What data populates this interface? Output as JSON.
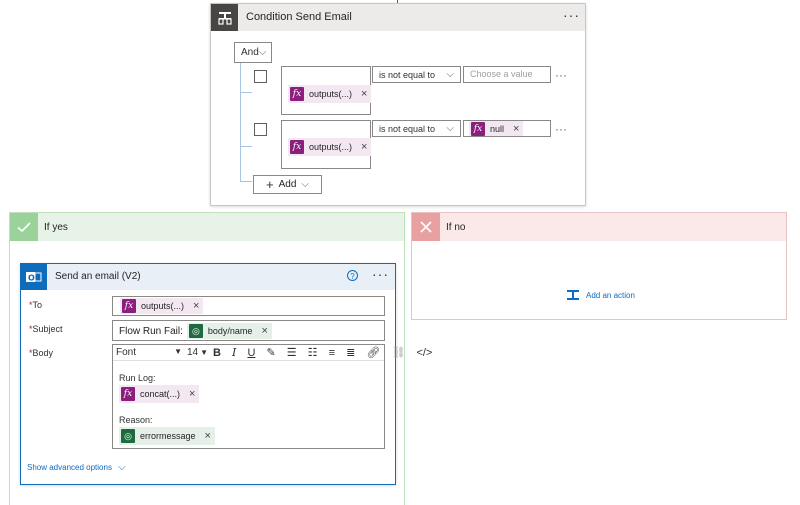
{
  "condition": {
    "title": "Condition Send Email",
    "menu": "···",
    "group_label": "And",
    "rows": [
      {
        "left_token": "outputs(...)",
        "operator": "is not equal to",
        "right_placeholder": "Choose a value",
        "right_token": ""
      },
      {
        "left_token": "outputs(...)",
        "operator": "is not equal to",
        "right_placeholder": "",
        "right_token": "null"
      }
    ],
    "row_menu": "···",
    "add_label": "Add"
  },
  "if_yes": {
    "title": "If yes"
  },
  "if_no": {
    "title": "If no",
    "add_action": "Add an action"
  },
  "email": {
    "title": "Send an email (V2)",
    "help": "?",
    "menu": "···",
    "to_label": "To",
    "to_token": "outputs(...)",
    "subject_label": "Subject",
    "subject_text": "Flow Run Fail:",
    "subject_token": "body/name",
    "body_label": "Body",
    "font": "Font",
    "font_size": "14",
    "run_log_label": "Run Log:",
    "run_log_token": "concat(...)",
    "reason_label": "Reason:",
    "reason_token": "errormessage",
    "advanced": "Show advanced options"
  },
  "colors": {
    "yes": "#e6f3e6",
    "yes_border": "#bfe0bf",
    "no": "#fbe9e9",
    "no_border": "#e8a0a0",
    "accent": "#0f6cbd",
    "fx": "#8a1f7e",
    "dataverse": "#1e6b3f"
  }
}
